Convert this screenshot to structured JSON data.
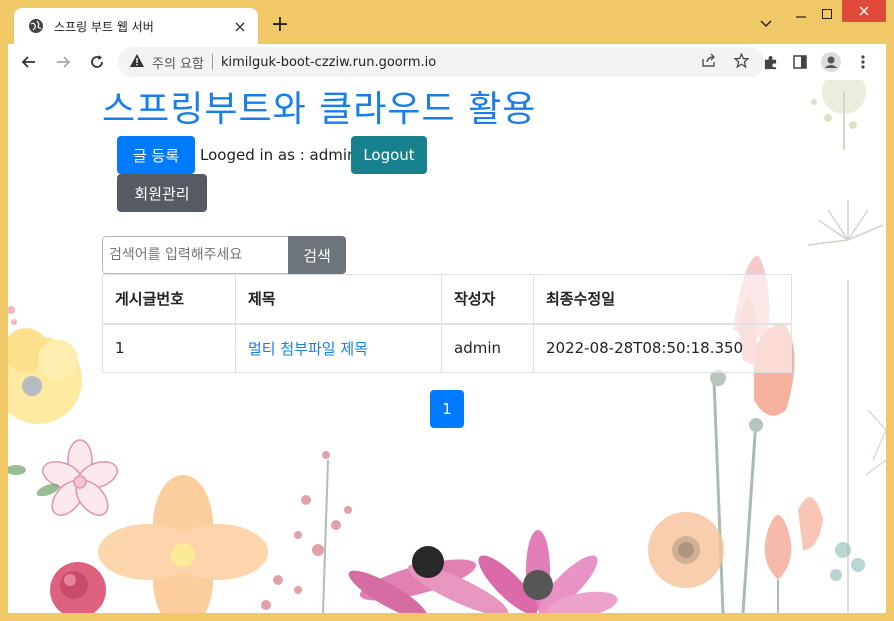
{
  "browser": {
    "tab_title": "스프링 부트 웹 서버",
    "tab_close": "×",
    "new_tab": "+",
    "security_label": "주의 요함",
    "url": "kimilguk-boot-czziw.run.goorm.io"
  },
  "page": {
    "title": "스프링부트와 클라우드 활용",
    "register_label": "글 등록",
    "login_text": "Looged in as : admin",
    "logout_label": "Logout",
    "members_label": "회원관리",
    "search_placeholder": "검색어를 입력해주세요",
    "search_label": "검색"
  },
  "table": {
    "headers": [
      "게시글번호",
      "제목",
      "작성자",
      "최종수정일"
    ],
    "rows": [
      [
        "1",
        "멀티 첨부파일 제목",
        "admin",
        "2022-08-28T08:50:18.350"
      ]
    ]
  },
  "pagination": {
    "current": "1"
  },
  "colors": {
    "accent": "#007bff",
    "title": "#1a7de8",
    "logout": "#17818e",
    "members": "#565b63",
    "frame": "#f0c868",
    "close_button": "#e04a3b"
  }
}
